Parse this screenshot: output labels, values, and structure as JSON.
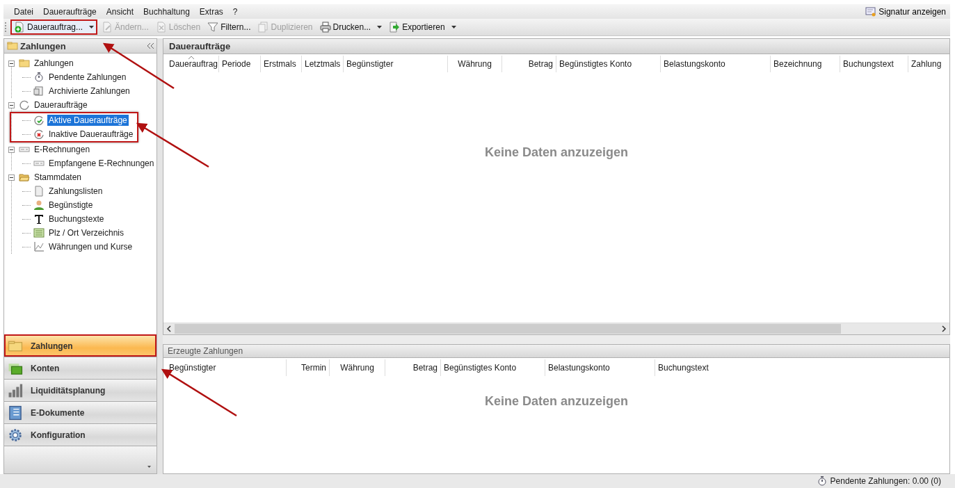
{
  "menu": [
    {
      "label": "Datei"
    },
    {
      "label": "Daueraufträge"
    },
    {
      "label": "Ansicht"
    },
    {
      "label": "Buchhaltung"
    },
    {
      "label": "Extras"
    },
    {
      "label": "?"
    }
  ],
  "signature": {
    "label": "Signatur anzeigen"
  },
  "toolbar": [
    {
      "label": "Dauerauftrag...",
      "kind": "add",
      "disabled": false,
      "dropdown": true,
      "highlighted": true
    },
    {
      "label": "Ändern...",
      "kind": "edit",
      "disabled": true,
      "dropdown": false,
      "highlighted": false
    },
    {
      "label": "Löschen",
      "kind": "delete",
      "disabled": true,
      "dropdown": false,
      "highlighted": false
    },
    {
      "label": "Filtern...",
      "kind": "filter",
      "disabled": false,
      "dropdown": false,
      "highlighted": false
    },
    {
      "label": "Duplizieren",
      "kind": "copy",
      "disabled": true,
      "dropdown": false,
      "highlighted": false
    },
    {
      "label": "Drucken...",
      "kind": "print",
      "disabled": false,
      "dropdown": true,
      "highlighted": false
    },
    {
      "label": "Exportieren",
      "kind": "export",
      "disabled": false,
      "dropdown": true,
      "highlighted": false
    }
  ],
  "left_panel": {
    "title": "Zahlungen",
    "tree": [
      {
        "label": "Zahlungen",
        "kind": "folder",
        "expanded": true,
        "selected": false,
        "highlight_children": false,
        "children": [
          {
            "label": "Pendente Zahlungen",
            "kind": "timer",
            "selected": false
          },
          {
            "label": "Archivierte Zahlungen",
            "kind": "archive",
            "selected": false
          }
        ]
      },
      {
        "label": "Daueraufträge",
        "kind": "cycle",
        "expanded": true,
        "selected": false,
        "highlight_children": true,
        "children": [
          {
            "label": "Aktive Daueraufträge",
            "kind": "check",
            "selected": true
          },
          {
            "label": "Inaktive Daueraufträge",
            "kind": "cross",
            "selected": false
          }
        ]
      },
      {
        "label": "E-Rechnungen",
        "kind": "invoice",
        "expanded": true,
        "selected": false,
        "highlight_children": false,
        "children": [
          {
            "label": "Empfangene E-Rechnungen",
            "kind": "invoice",
            "selected": false
          }
        ]
      },
      {
        "label": "Stammdaten",
        "kind": "openfolder",
        "expanded": true,
        "selected": false,
        "highlight_children": false,
        "children": [
          {
            "label": "Zahlungslisten",
            "kind": "document",
            "selected": false
          },
          {
            "label": "Begünstigte",
            "kind": "person",
            "selected": false
          },
          {
            "label": "Buchungstexte",
            "kind": "text",
            "selected": false
          },
          {
            "label": "Plz / Ort Verzeichnis",
            "kind": "list",
            "selected": false
          },
          {
            "label": "Währungen und Kurse",
            "kind": "chart",
            "selected": false
          }
        ]
      }
    ]
  },
  "nav": [
    {
      "label": "Zahlungen",
      "kind": "folder",
      "selected": true,
      "highlighted": true
    },
    {
      "label": "Konten",
      "kind": "accounts",
      "selected": false,
      "highlighted": false
    },
    {
      "label": "Liquiditätsplanung",
      "kind": "bars",
      "selected": false,
      "highlighted": false
    },
    {
      "label": "E-Dokumente",
      "kind": "book",
      "selected": false,
      "highlighted": false
    },
    {
      "label": "Konfiguration",
      "kind": "gear",
      "selected": false,
      "highlighted": false
    }
  ],
  "main": {
    "title": "Daueraufträge",
    "columns": [
      {
        "label": "Dauerauftrag",
        "sorted": true
      },
      {
        "label": "Periode",
        "sorted": false
      },
      {
        "label": "Erstmals",
        "sorted": false
      },
      {
        "label": "Letztmals",
        "sorted": false
      },
      {
        "label": "Begünstigter",
        "sorted": false
      },
      {
        "label": "Währung",
        "sorted": false
      },
      {
        "label": "Betrag",
        "sorted": false
      },
      {
        "label": "Begünstigtes Konto",
        "sorted": false
      },
      {
        "label": "Belastungskonto",
        "sorted": false
      },
      {
        "label": "Bezeichnung",
        "sorted": false
      },
      {
        "label": "Buchungstext",
        "sorted": false
      },
      {
        "label": "Zahlung",
        "sorted": false
      }
    ],
    "empty_text": "Keine Daten anzuzeigen"
  },
  "lower": {
    "title": "Erzeugte Zahlungen",
    "columns": [
      {
        "label": "Begünstigter"
      },
      {
        "label": "Termin"
      },
      {
        "label": "Währung"
      },
      {
        "label": "Betrag"
      },
      {
        "label": "Begünstigtes Konto"
      },
      {
        "label": "Belastungskonto"
      },
      {
        "label": "Buchungstext"
      }
    ],
    "empty_text": "Keine Daten anzuzeigen"
  },
  "status_bar": {
    "text": "Pendente Zahlungen: 0.00 (0)"
  }
}
